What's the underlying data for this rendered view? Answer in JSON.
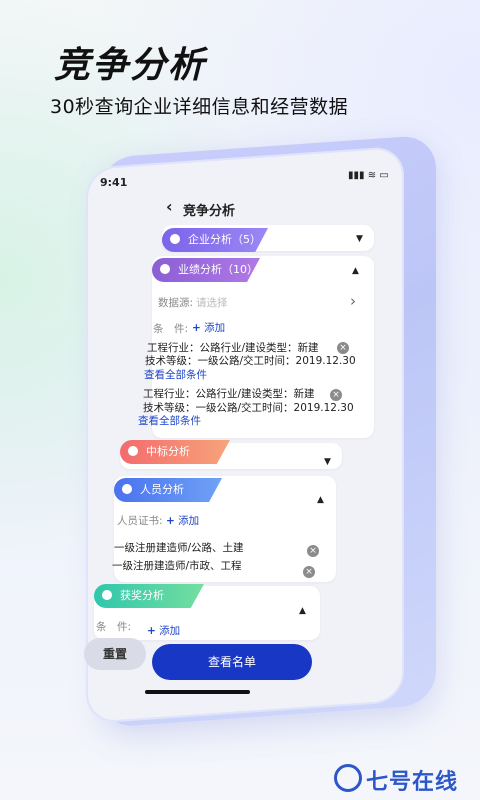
{
  "promo": {
    "title": "竞争分析",
    "subtitle": "30秒查询企业详细信息和经营数据"
  },
  "status": {
    "time": "9:41",
    "icons": "▮▮▮ ≋ ▭"
  },
  "nav": {
    "back": "‹",
    "title": "竞争分析"
  },
  "sections": {
    "enterprise": {
      "label": "企业分析（5）",
      "caret": "▼"
    },
    "performance": {
      "label": "业绩分析（10）",
      "caret": "▲",
      "data_source_label": "数据源:",
      "data_source_placeholder": "请选择",
      "chevron": "›",
      "condition_label": "条　件:",
      "add_label": "添加",
      "conditions": [
        {
          "line1": "工程行业：公路行业/建设类型：新建",
          "line2": "技术等级：一级公路/交工时间：2019.12.30",
          "link": "查看全部条件"
        },
        {
          "line1": "工程行业：公路行业/建设类型：新建",
          "line2": "技术等级：一级公路/交工时间：2019.12.30",
          "link": "查看全部条件"
        }
      ]
    },
    "bidding": {
      "label": "中标分析",
      "caret": "▼"
    },
    "personnel": {
      "label": "人员分析",
      "caret": "▲",
      "cert_label": "人员证书:",
      "add_label": "添加",
      "items": [
        "一级注册建造师/公路、土建",
        "一级注册建造师/市政、工程"
      ]
    },
    "awards": {
      "label": "获奖分析",
      "caret": "▲",
      "condition_label": "条　件:",
      "add_label": "添加"
    }
  },
  "buttons": {
    "reset": "重置",
    "view_list": "查看名单"
  },
  "watermark": {
    "text": "七号在线"
  },
  "colors": {
    "enterprise": "#7c63ea",
    "performance": "#8c5cd6",
    "bidding": "#f06f6a",
    "personnel": "#4f79ef",
    "awards": "#3cc8a0",
    "primary": "#1937c5"
  }
}
